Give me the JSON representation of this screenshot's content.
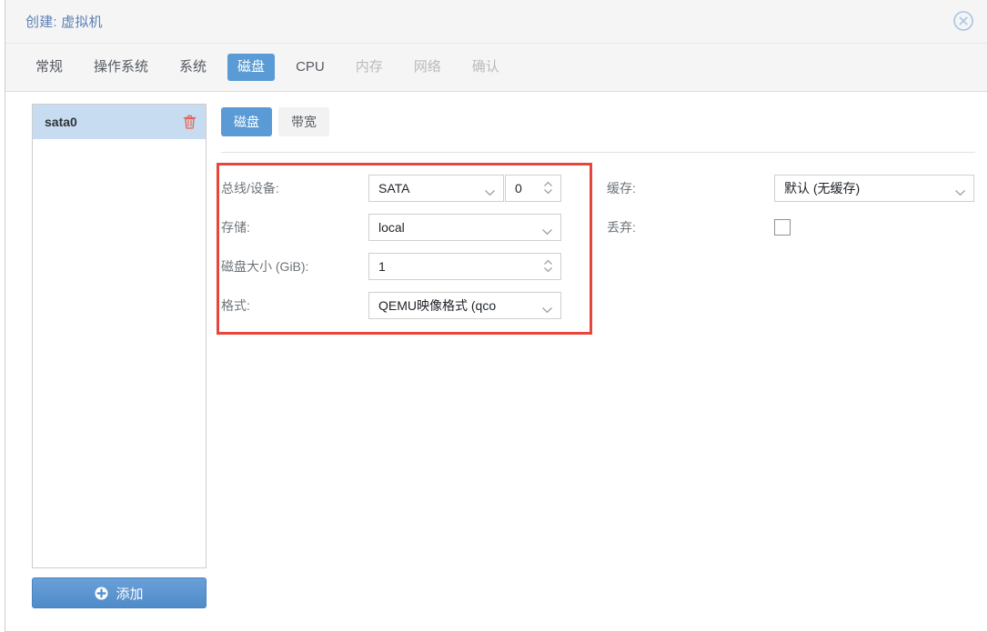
{
  "window": {
    "title": "创建: 虚拟机",
    "close_icon": "close-circle-icon"
  },
  "tabs": [
    {
      "label": "常规",
      "state": "enabled"
    },
    {
      "label": "操作系统",
      "state": "enabled"
    },
    {
      "label": "系统",
      "state": "enabled"
    },
    {
      "label": "磁盘",
      "state": "active"
    },
    {
      "label": "CPU",
      "state": "enabled"
    },
    {
      "label": "内存",
      "state": "disabled"
    },
    {
      "label": "网络",
      "state": "disabled"
    },
    {
      "label": "确认",
      "state": "disabled"
    }
  ],
  "sidebar": {
    "devices": [
      {
        "name": "sata0",
        "selected": true,
        "delete_icon": "trash-icon"
      }
    ],
    "add_button": {
      "label": "添加",
      "icon": "plus-circle-icon"
    }
  },
  "subtabs": [
    {
      "label": "磁盘",
      "state": "active"
    },
    {
      "label": "带宽",
      "state": "enabled"
    }
  ],
  "form": {
    "left": {
      "bus_device": {
        "label": "总线/设备:",
        "bus_value": "SATA",
        "device_value": "0"
      },
      "storage": {
        "label": "存储:",
        "value": "local"
      },
      "disk_size": {
        "label": "磁盘大小 (GiB):",
        "value": "1"
      },
      "format": {
        "label": "格式:",
        "value": "QEMU映像格式 (qco"
      }
    },
    "right": {
      "cache": {
        "label": "缓存:",
        "value": "默认 (无缓存)"
      },
      "discard": {
        "label": "丢弃:",
        "checked": false
      }
    }
  },
  "colors": {
    "accent_blue": "#5a9bd5",
    "title_blue": "#5b7fb4",
    "highlight_red": "#e8463c",
    "selected_row": "#c7dcf0",
    "trash_red": "#e8604f"
  }
}
